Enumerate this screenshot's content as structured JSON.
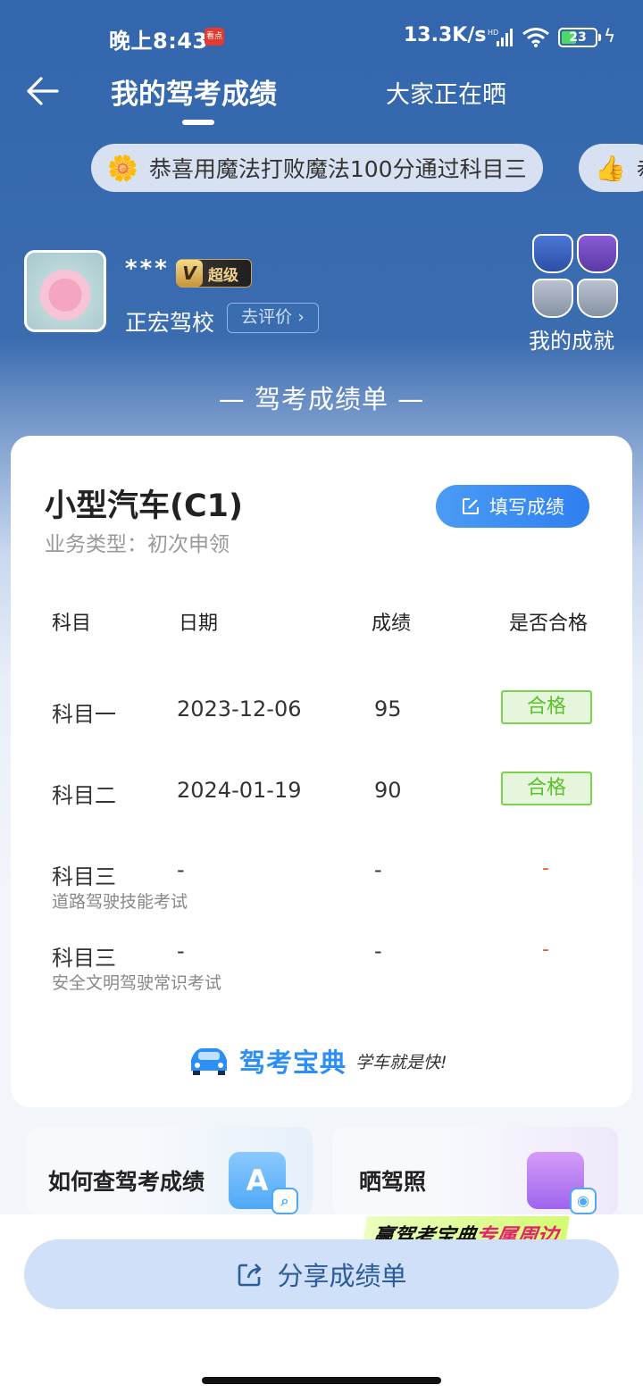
{
  "status_bar": {
    "time": "晚上8:43",
    "app_badge": "看点",
    "network_speed": "13.3K/s",
    "network_type": "HD",
    "battery": "23"
  },
  "nav": {
    "active_tab": "我的驾考成绩",
    "other_tab": "大家正在晒"
  },
  "marquee": {
    "items": [
      {
        "icon": "flower-emoji",
        "text": "恭喜用魔法打败魔法100分通过科目三"
      },
      {
        "icon": "thumbs-up-emoji",
        "text": "恭"
      }
    ]
  },
  "profile": {
    "username": "***",
    "vip_letter": "V",
    "vip_label": "超级",
    "school": "正宏驾校",
    "rate_button": "去评价 ›",
    "achievements_label": "我的成就"
  },
  "section_title": "— 驾考成绩单 —",
  "card": {
    "car_type": "小型汽车(C1)",
    "business_type": "业务类型：初次申领",
    "fill_button": "填写成绩",
    "columns": [
      "科目",
      "日期",
      "成绩",
      "是否合格"
    ],
    "rows": [
      {
        "subject": "科目一",
        "sub": "",
        "date": "2023-12-06",
        "score": "95",
        "passed": "合格"
      },
      {
        "subject": "科目二",
        "sub": "",
        "date": "2024-01-19",
        "score": "90",
        "passed": "合格"
      },
      {
        "subject": "科目三",
        "sub": "道路驾驶技能考试",
        "date": "-",
        "score": "-",
        "passed": "-"
      },
      {
        "subject": "科目三",
        "sub": "安全文明驾驶常识考试",
        "date": "-",
        "score": "-",
        "passed": "-"
      }
    ],
    "brand_name": "驾考宝典",
    "brand_slogan": "学车就是快!"
  },
  "mini_cards": [
    {
      "title": "如何查驾考成绩",
      "art_letter": "A"
    },
    {
      "title": "晒驾照"
    }
  ],
  "promo": {
    "part1": "赢驾考宝典",
    "part2": "专属周边"
  },
  "share_button": "分享成绩单",
  "colors": {
    "header_blue": "#3366ad",
    "accent_blue": "#2f7ff0",
    "pass_green": "#5ac12a",
    "dash_red": "#f05a28"
  }
}
